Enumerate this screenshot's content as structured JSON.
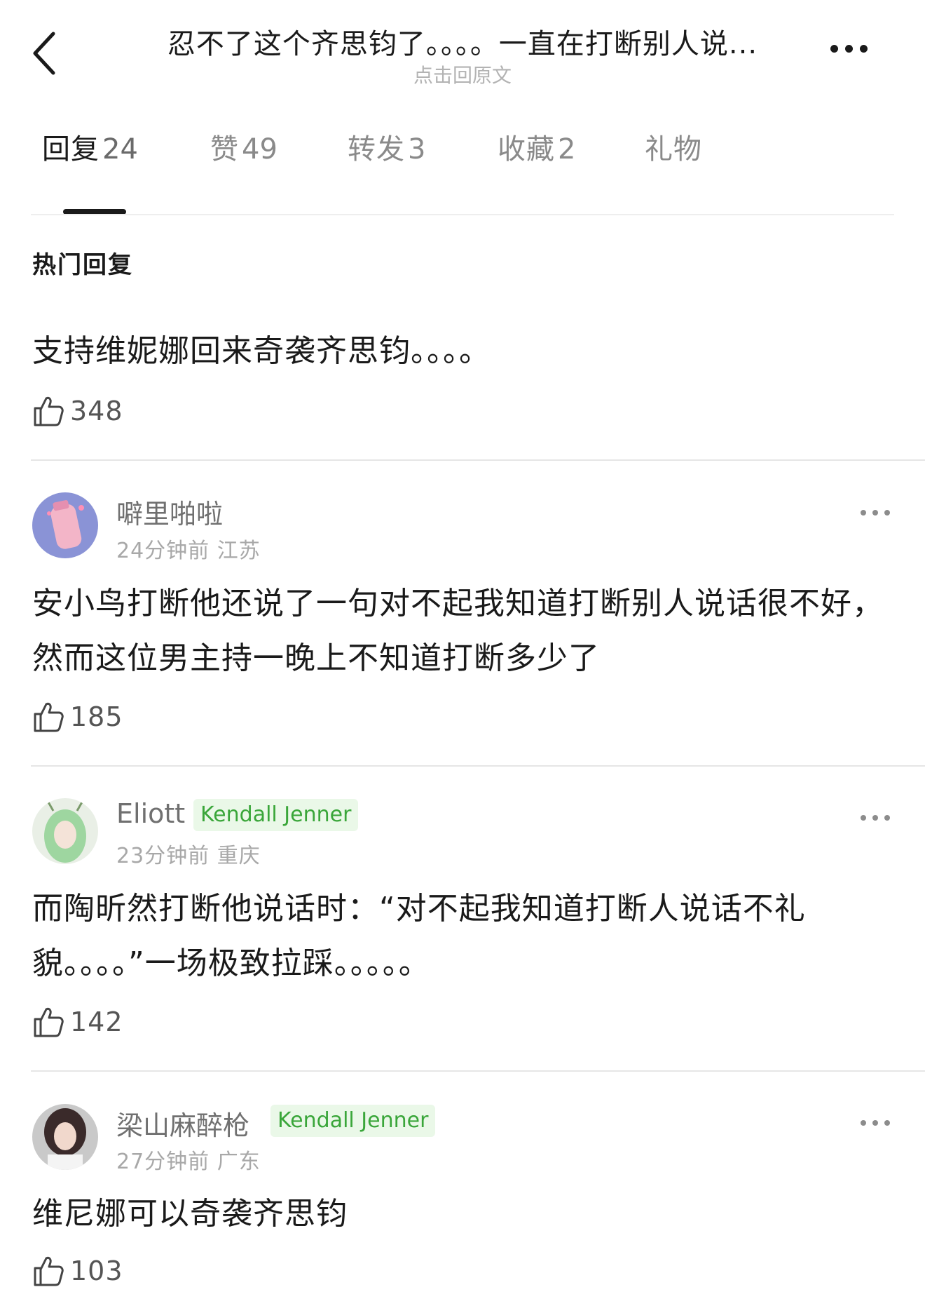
{
  "header": {
    "title": "忍不了这个齐思钧了。。。。一直在打断别人说...",
    "subtitle": "点击回原文",
    "back_icon": "chevron-left-icon",
    "more_icon": "more-horizontal-icon"
  },
  "tabs": [
    {
      "label": "回复",
      "count": "24",
      "active": true
    },
    {
      "label": "赞",
      "count": "49"
    },
    {
      "label": "转发",
      "count": "3"
    },
    {
      "label": "收藏",
      "count": "2"
    },
    {
      "label": "礼物",
      "count": ""
    }
  ],
  "section_title": "热门回复",
  "comments": [
    {
      "text": "支持维妮娜回来奇袭齐思钧。。。。",
      "likes": "348"
    },
    {
      "username": "噼里啪啦",
      "time": "24分钟前",
      "location": "江苏",
      "text": "安小鸟打断他还说了一句对不起我知道打断别人说话很不好，然而这位男主持一晚上不知道打断多少了",
      "likes": "185"
    },
    {
      "username": "Eliott",
      "badge": "Kendall Jenner",
      "time": "23分钟前",
      "location": "重庆",
      "text": "而陶昕然打断他说话时：“对不起我知道打断人说话不礼貌。。。。”一场极致拉踩。。。。。",
      "likes": "142"
    },
    {
      "username": "梁山麻醉枪",
      "badge": "Kendall Jenner",
      "time": "27分钟前",
      "location": "广东",
      "text": "维尼娜可以奇袭齐思钧",
      "likes": "103"
    }
  ],
  "colors": {
    "badge_text": "#3aa63a",
    "badge_bg": "#eaf8e8",
    "muted": "#a8a8a8"
  }
}
